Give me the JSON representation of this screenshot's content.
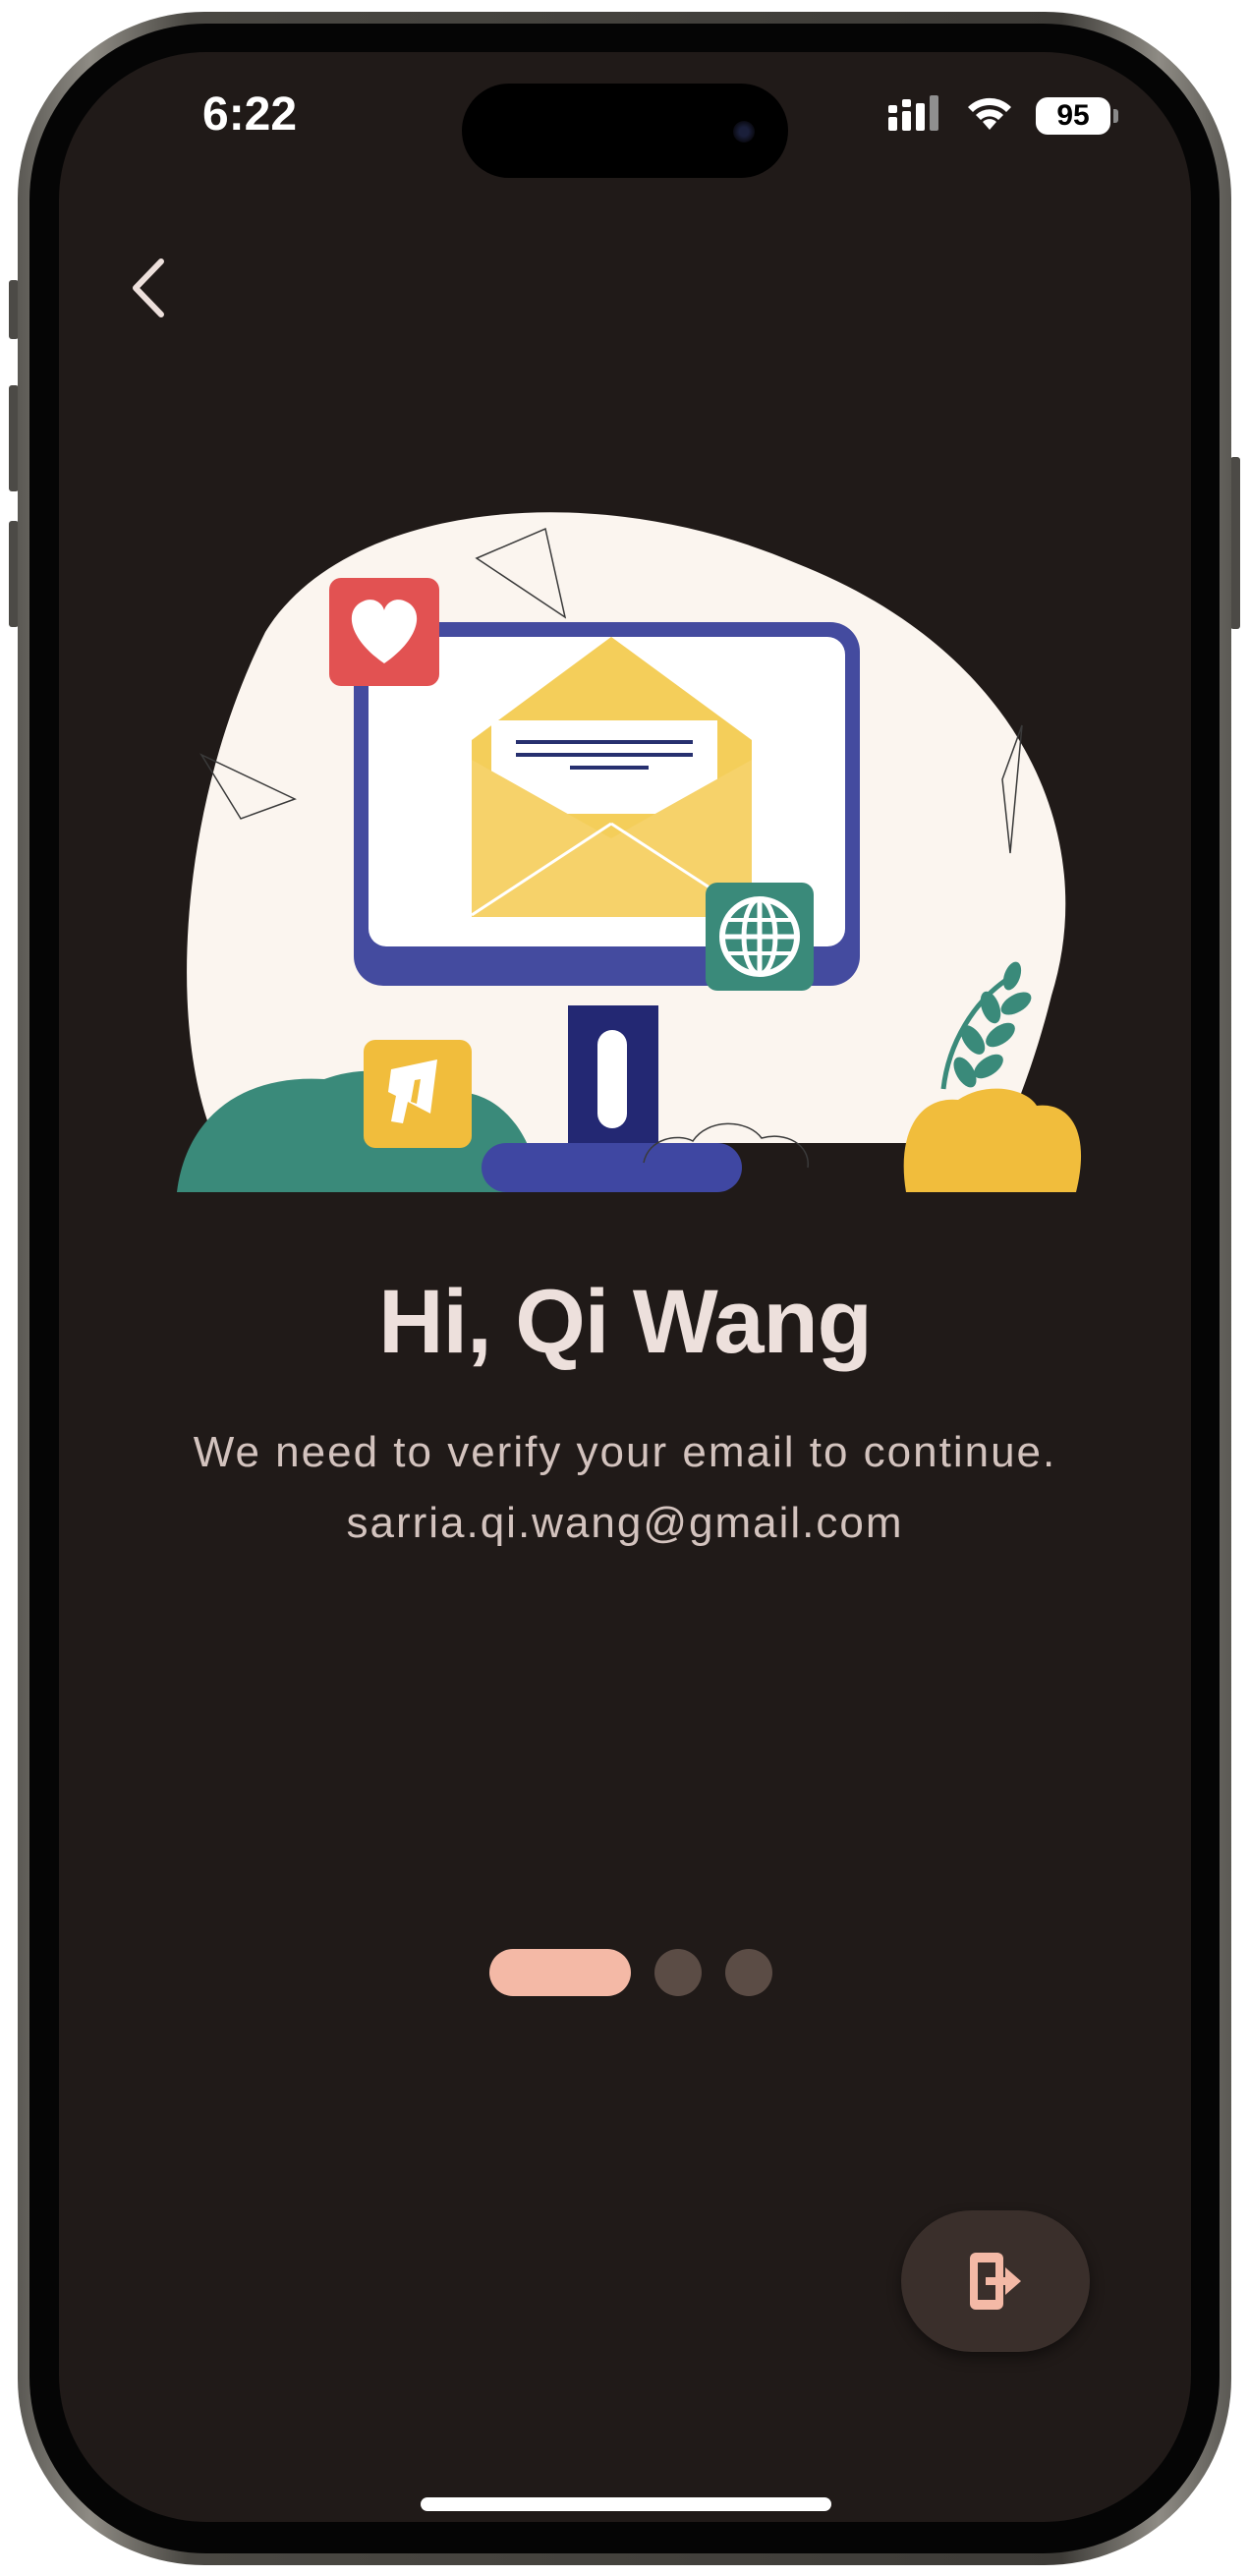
{
  "status_bar": {
    "time": "6:22",
    "battery_level": "95",
    "icons": [
      "cellular-signal-icon",
      "wifi-icon",
      "battery-icon"
    ]
  },
  "navigation": {
    "back_icon": "chevron-left-icon"
  },
  "illustration": {
    "subject": "email-verification-illustration",
    "icons": [
      "heart-icon",
      "envelope-icon",
      "globe-icon",
      "megaphone-icon",
      "plant-icon"
    ]
  },
  "content": {
    "greeting": "Hi, Qi Wang",
    "subtitle": "We need to verify your email to continue.",
    "email": "sarria.qi.wang@gmail.com"
  },
  "pager": {
    "total_pages": 3,
    "current_page": 1
  },
  "fab": {
    "icon": "logout-icon"
  },
  "colors": {
    "background": "#201a18",
    "primary": "#f4b9a6",
    "text_primary": "#ede0dc",
    "text_secondary": "#d3c3be",
    "inactive_dot": "#5b4c45",
    "fab_background": "#3a2f2b"
  }
}
